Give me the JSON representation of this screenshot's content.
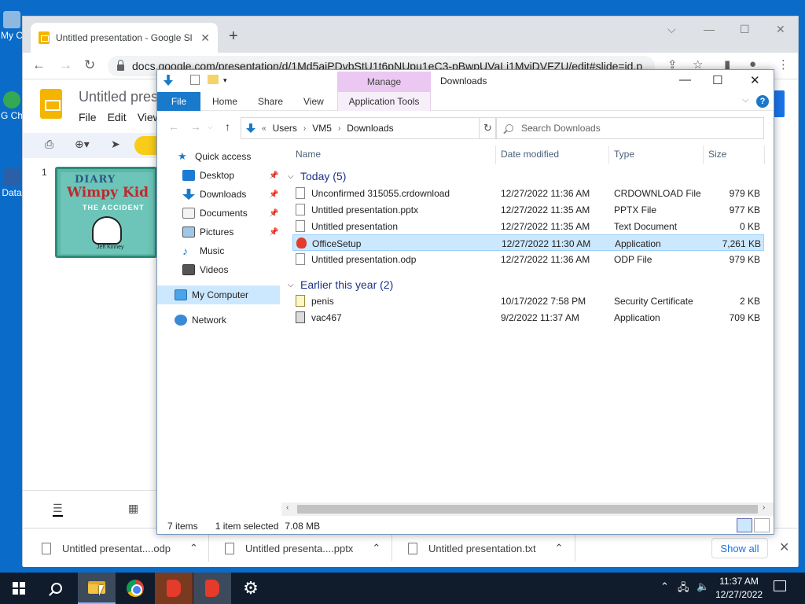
{
  "desktop": {
    "icons": [
      {
        "label": "My C",
        "icon": "computer-icon"
      },
      {
        "label": "G Ch",
        "icon": "chrome-icon"
      },
      {
        "label": "Data",
        "icon": "shortcut-icon"
      }
    ]
  },
  "chrome": {
    "tab_title": "Untitled presentation - Google Sl",
    "url": "docs.google.com/presentation/d/1Md5aiPDvbStU1t6pNUpu1eC3-pBwpUVaLi1MviDVFZU/edit#slide=id.p",
    "slides": {
      "title": "Untitled pres",
      "menu": [
        "File",
        "Edit",
        "View"
      ],
      "slide_number": "1",
      "thumbnail": {
        "line1": "DIARY",
        "line2": "Wimpy Kid",
        "line3": "THE ACCIDENT",
        "author": "Jeff Kinney"
      }
    },
    "downloads": [
      {
        "name": "Untitled presentat....odp"
      },
      {
        "name": "Untitled presenta....pptx"
      },
      {
        "name": "Untitled presentation.txt"
      }
    ],
    "show_all": "Show all"
  },
  "explorer": {
    "title": "Downloads",
    "manage": "Manage",
    "ribbon_tabs": [
      "File",
      "Home",
      "Share",
      "View",
      "Application Tools"
    ],
    "path": [
      "Users",
      "VM5",
      "Downloads"
    ],
    "path_prefix": "«",
    "search_placeholder": "Search Downloads",
    "nav": [
      {
        "label": "Quick access",
        "icon": "star-icon",
        "pinned": false
      },
      {
        "label": "Desktop",
        "icon": "desktop-icon",
        "pinned": true
      },
      {
        "label": "Downloads",
        "icon": "downloads-icon",
        "pinned": true
      },
      {
        "label": "Documents",
        "icon": "documents-icon",
        "pinned": true
      },
      {
        "label": "Pictures",
        "icon": "pictures-icon",
        "pinned": true
      },
      {
        "label": "Music",
        "icon": "music-icon",
        "pinned": false
      },
      {
        "label": "Videos",
        "icon": "videos-icon",
        "pinned": false
      },
      {
        "label": "My Computer",
        "icon": "computer-icon",
        "pinned": false
      },
      {
        "label": "Network",
        "icon": "network-icon",
        "pinned": false
      }
    ],
    "columns": [
      "Name",
      "Date modified",
      "Type",
      "Size"
    ],
    "groups": [
      {
        "label": "Today (5)",
        "files": [
          {
            "name": "Unconfirmed 315055.crdownload",
            "date": "12/27/2022 11:36 AM",
            "type": "CRDOWNLOAD File",
            "size": "979 KB",
            "icon": "document-icon",
            "selected": false
          },
          {
            "name": "Untitled presentation.pptx",
            "date": "12/27/2022 11:35 AM",
            "type": "PPTX File",
            "size": "977 KB",
            "icon": "document-icon",
            "selected": false
          },
          {
            "name": "Untitled presentation",
            "date": "12/27/2022 11:35 AM",
            "type": "Text Document",
            "size": "0 KB",
            "icon": "document-icon",
            "selected": false
          },
          {
            "name": "OfficeSetup",
            "date": "12/27/2022 11:30 AM",
            "type": "Application",
            "size": "7,261 KB",
            "icon": "office-icon",
            "selected": true
          },
          {
            "name": "Untitled presentation.odp",
            "date": "12/27/2022 11:36 AM",
            "type": "ODP File",
            "size": "979 KB",
            "icon": "document-icon",
            "selected": false
          }
        ]
      },
      {
        "label": "Earlier this year (2)",
        "files": [
          {
            "name": "penis",
            "date": "10/17/2022 7:58 PM",
            "type": "Security Certificate",
            "size": "2 KB",
            "icon": "certificate-icon",
            "selected": false
          },
          {
            "name": "vac467",
            "date": "9/2/2022 11:37 AM",
            "type": "Application",
            "size": "709 KB",
            "icon": "application-icon",
            "selected": false
          }
        ]
      }
    ],
    "status": {
      "items": "7 items",
      "selected": "1 item selected",
      "size": "7.08 MB"
    }
  },
  "taskbar": {
    "time": "11:37 AM",
    "date": "12/27/2022"
  }
}
